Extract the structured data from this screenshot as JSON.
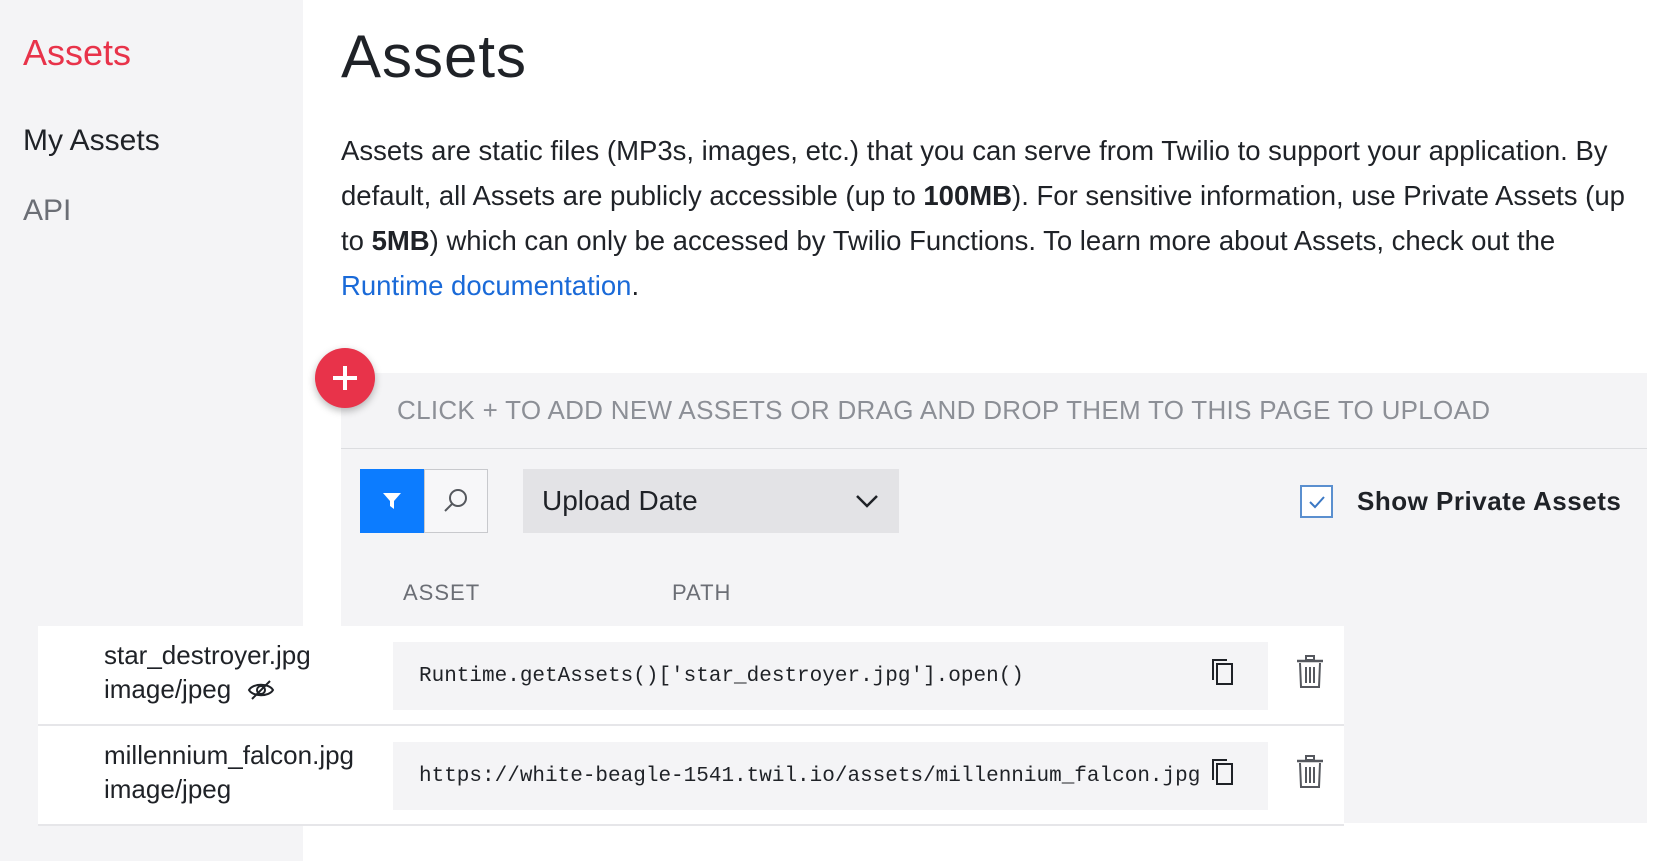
{
  "sidebar": {
    "section_title": "Assets",
    "items": [
      {
        "label": "My Assets",
        "active": true
      },
      {
        "label": "API",
        "active": false
      }
    ]
  },
  "main": {
    "title": "Assets",
    "intro": {
      "part1": "Assets are static files (MP3s, images, etc.) that you can serve from Twilio to support your application. By default, all Assets are publicly accessible (up to ",
      "bold1": "100MB",
      "part2": "). For sensitive information, use Private Assets (up to ",
      "bold2": "5MB",
      "part3": ") which can only be accessed by Twilio Functions. To learn more about Assets, check out the ",
      "link": "Runtime documentation",
      "part4": "."
    }
  },
  "upload": {
    "hint": "CLICK + TO ADD NEW ASSETS OR DRAG AND DROP THEM TO THIS PAGE TO UPLOAD",
    "add_icon": "plus-icon"
  },
  "toolbar": {
    "filter_icon": "filter-icon",
    "search_icon": "search-icon",
    "sort_value": "Upload Date",
    "show_private_label": "Show Private Assets",
    "show_private_checked": true
  },
  "table": {
    "columns": [
      "ASSET",
      "PATH"
    ],
    "rows": [
      {
        "name": "star_destroyer.jpg",
        "type": "image/jpeg",
        "private": true,
        "path": "Runtime.getAssets()['star_destroyer.jpg'].open()"
      },
      {
        "name": "millennium_falcon.jpg",
        "type": "image/jpeg",
        "private": false,
        "path": "https://white-beagle-1541.twil.io/assets/millennium_falcon.jpg"
      }
    ]
  },
  "colors": {
    "accent_red": "#e8334a",
    "accent_blue": "#0c7cff",
    "link_blue": "#1a6ad8",
    "panel_bg": "#f4f4f6"
  }
}
